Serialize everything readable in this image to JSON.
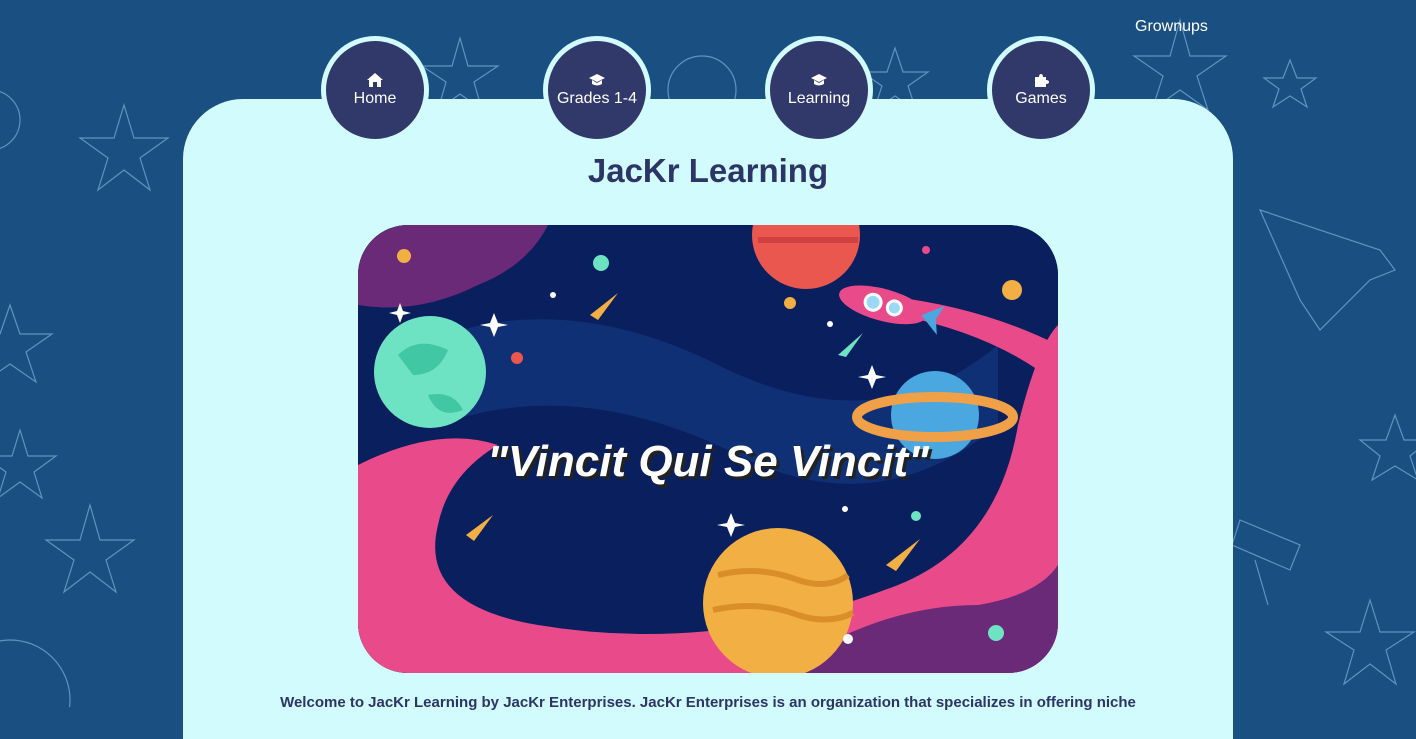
{
  "header": {
    "grownups_link": "Grownups"
  },
  "nav": [
    {
      "label": "Home",
      "icon": "home-icon"
    },
    {
      "label": "Grades 1-4",
      "icon": "graduation-cap-icon"
    },
    {
      "label": "Learning",
      "icon": "graduation-cap-icon"
    },
    {
      "label": "Games",
      "icon": "puzzle-piece-icon"
    }
  ],
  "main": {
    "title": "JacKr Learning",
    "hero_motto": "\"Vincit Qui Se Vincit\"",
    "intro_text": "Welcome to JacKr Learning by JacKr Enterprises. JacKr Enterprises is an organization that specializes in offering niche"
  },
  "colors": {
    "background": "#1a4f82",
    "panel": "#d1fbfc",
    "nav_button": "#31386a",
    "title_text": "#2c3566",
    "hero_pink": "#e94b8a",
    "hero_navy": "#0a1f5e"
  }
}
